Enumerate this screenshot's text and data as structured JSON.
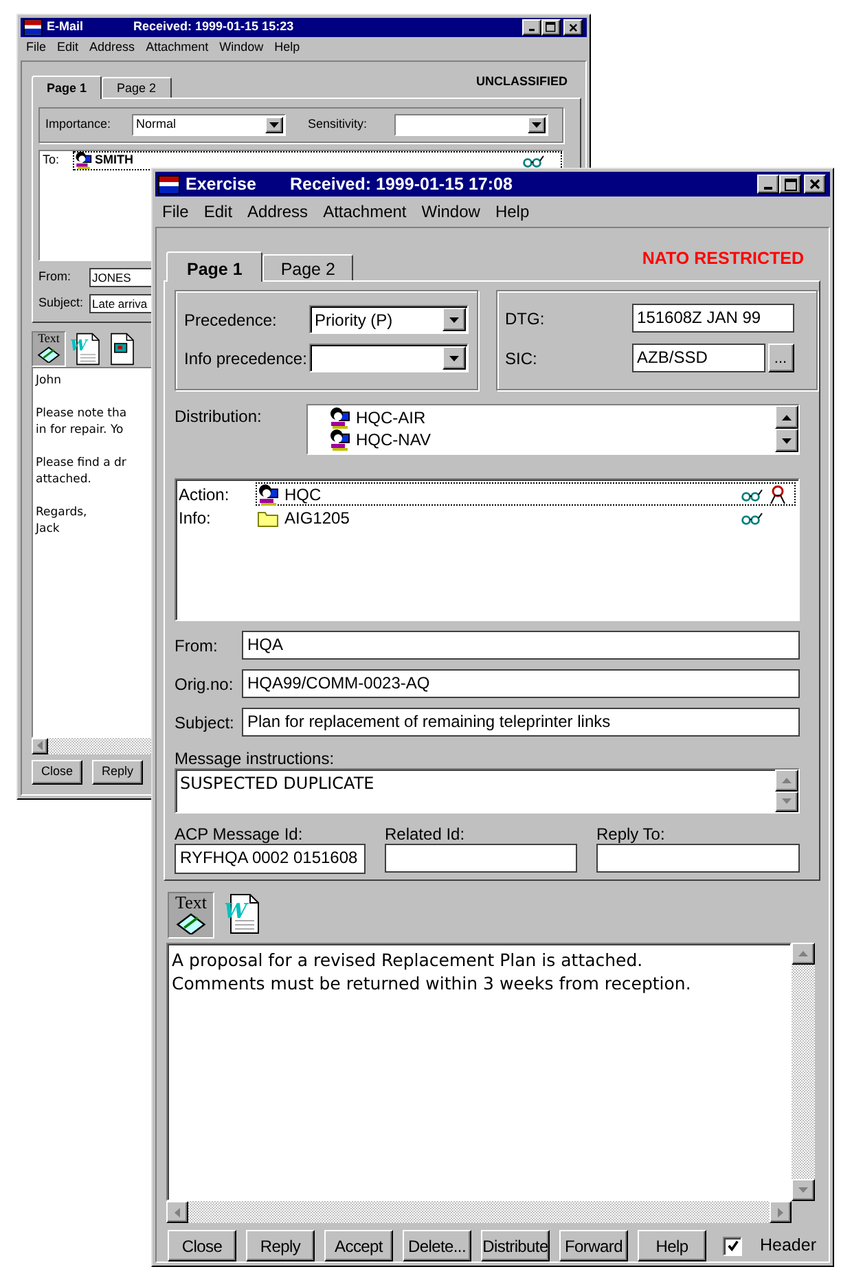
{
  "email_window": {
    "title": "E-Mail",
    "received": "Received: 1999-01-15 15:23",
    "menu": [
      "File",
      "Edit",
      "Address",
      "Attachment",
      "Window",
      "Help"
    ],
    "tabs": [
      {
        "label": "Page 1",
        "selected": true
      },
      {
        "label": "Page 2",
        "selected": false
      }
    ],
    "classification": "UNCLASSIFIED",
    "importance": {
      "label": "Importance:",
      "value": "Normal"
    },
    "sensitivity": {
      "label": "Sensitivity:"
    },
    "recipients": [
      {
        "role": "To:",
        "kind": "person",
        "name": "SMITH",
        "selected": true,
        "alert": false
      }
    ],
    "from": {
      "label": "From:",
      "value": "JONES"
    },
    "subject": {
      "label": "Subject:",
      "value": "Late arriva"
    },
    "attachments": [
      {
        "kind": "text",
        "label": "Text",
        "selected": true
      },
      {
        "kind": "word",
        "label": "W",
        "selected": false
      },
      {
        "kind": "presentation",
        "selected": false
      }
    ],
    "body": [
      [
        "John"
      ],
      [
        "Please note tha",
        "in for repair. Yo"
      ],
      [
        "Please find a dr",
        "attached."
      ],
      [
        "Regards,",
        "Jack"
      ]
    ],
    "buttons": [
      "Close",
      "Reply"
    ]
  },
  "exercise_window": {
    "title": "Exercise",
    "received": "Received: 1999-01-15 17:08",
    "menu": [
      "File",
      "Edit",
      "Address",
      "Attachment",
      "Window",
      "Help"
    ],
    "tabs": [
      {
        "label": "Page 1",
        "selected": true
      },
      {
        "label": "Page 2",
        "selected": false
      }
    ],
    "classification": "NATO RESTRICTED",
    "precedence": {
      "label": "Precedence:",
      "value": "Priority (P)"
    },
    "info_precedence": {
      "label": "Info precedence:"
    },
    "dtg": {
      "label": "DTG:",
      "value": "151608Z JAN 99"
    },
    "sic": {
      "label": "SIC:",
      "value": "AZB/SSD",
      "button": "..."
    },
    "distribution": {
      "label": "Distribution:",
      "items": [
        "HQC-AIR",
        "HQC-NAV"
      ]
    },
    "recipients": [
      {
        "role": "Action:",
        "kind": "person",
        "name": "HQC",
        "selected": true,
        "alert": true
      },
      {
        "role": "Info:",
        "kind": "folder",
        "name": "AIG1205",
        "selected": false,
        "alert": false
      }
    ],
    "from": {
      "label": "From:",
      "value": "HQA"
    },
    "orig_no": {
      "label": "Orig.no:",
      "value": "HQA99/COMM-0023-AQ"
    },
    "subject": {
      "label": "Subject:",
      "value": "Plan for replacement of remaining teleprinter links"
    },
    "message_instructions": {
      "label": "Message instructions:",
      "value": "SUSPECTED DUPLICATE"
    },
    "acp_message_id": {
      "label": "ACP Message Id:",
      "value": "RYFHQA 0002 0151608"
    },
    "related_id": {
      "label": "Related Id:"
    },
    "reply_to": {
      "label": "Reply To:"
    },
    "attachments": [
      {
        "kind": "text",
        "label": "Text",
        "selected": true
      },
      {
        "kind": "word",
        "label": "W",
        "selected": false
      }
    ],
    "body": [
      "A proposal for a revised Replacement Plan is attached.",
      "Comments must be returned within 3 weeks from reception."
    ],
    "buttons": [
      "Close",
      "Reply",
      "Accept",
      "Delete...",
      "Distribute",
      "Forward",
      "Help"
    ],
    "header_checkbox": {
      "label": "Header",
      "checked": true
    }
  }
}
